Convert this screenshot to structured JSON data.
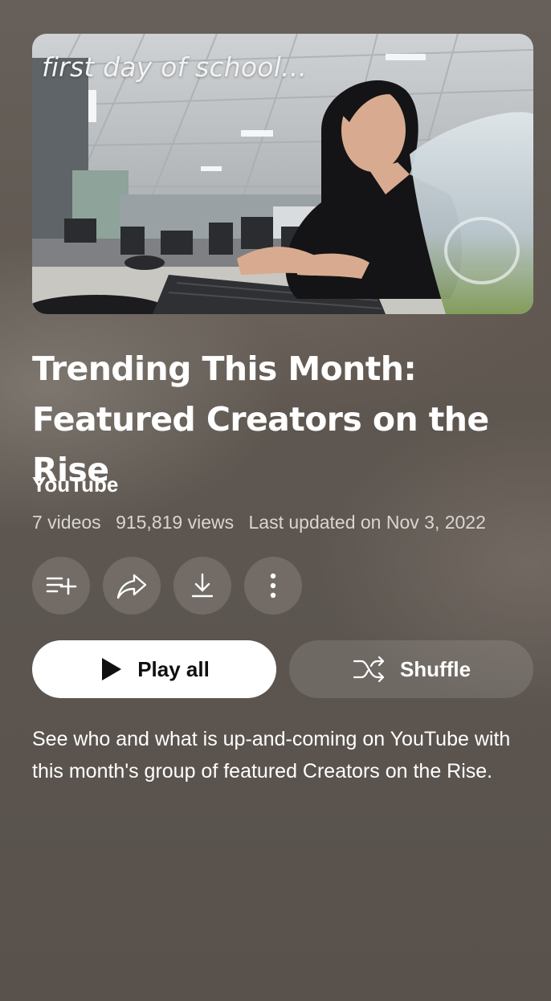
{
  "playlist": {
    "thumbnail": {
      "caption": "first day of school...",
      "icon": "video-thumbnail"
    },
    "title": "Trending This Month: Featured Creators on the Rise",
    "channel": "YouTube",
    "stats": {
      "videos": "7 videos",
      "views": "915,819 views",
      "updated": "Last updated on Nov 3, 2022"
    },
    "actions": {
      "save_icon": "playlist-add-icon",
      "share_icon": "share-icon",
      "download_icon": "download-icon",
      "more_icon": "more-vertical-icon"
    },
    "buttons": {
      "play_all": "Play all",
      "shuffle": "Shuffle"
    },
    "description": "See who and what is up-and-coming on YouTube with this month's group of featured Creators on the Rise."
  },
  "colors": {
    "background": "#5a524c",
    "play_button_bg": "#ffffff",
    "play_button_text": "#0f0f0f",
    "secondary_button_bg": "rgba(255,255,255,0.12)",
    "meta_text": "#d9d5d1"
  }
}
